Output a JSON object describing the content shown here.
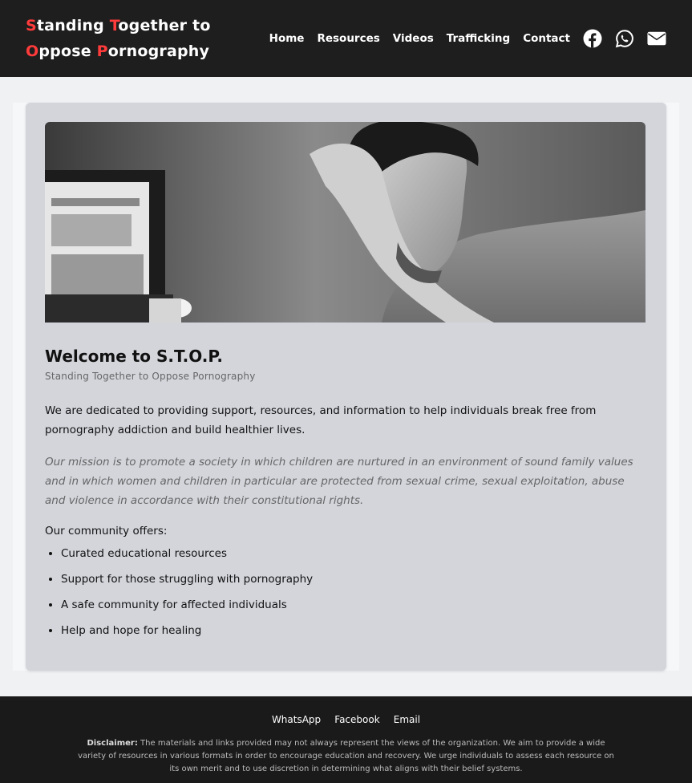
{
  "header": {
    "logo_line1": [
      {
        "accent": "S",
        "rest": "tanding "
      },
      {
        "accent": "T",
        "rest": "ogether to"
      }
    ],
    "logo_line2": [
      {
        "accent": "O",
        "rest": "ppose "
      },
      {
        "accent": "P",
        "rest": "ornography"
      }
    ],
    "nav": [
      "Home",
      "Resources",
      "Videos",
      "Trafficking",
      "Contact"
    ],
    "icons": [
      "facebook-icon",
      "whatsapp-icon",
      "envelope-icon"
    ]
  },
  "hero_image": "grayscale-photo-distressed-young-man-at-computer",
  "content": {
    "title": "Welcome to S.T.O.P.",
    "subtitle": "Standing Together to Oppose Pornography",
    "lead": "We are dedicated to providing support, resources, and information to help individuals break free from pornography addiction and build healthier lives.",
    "mission": "Our mission is to promote a society in which children are nurtured in an environment of sound family values and in which women and children in particular are protected from sexual crime, sexual exploitation, abuse and violence in accordance with their constitutional rights.",
    "offers_label": "Our community offers:",
    "offers": [
      "Curated educational resources",
      "Support for those struggling with pornography",
      "A safe community for affected individuals",
      "Help and hope for healing"
    ]
  },
  "footer": {
    "links": [
      "WhatsApp",
      "Facebook",
      "Email"
    ],
    "disclaimer_label": "Disclaimer:",
    "disclaimer_text": "The materials and links provided may not always represent the views of the organization. We aim to provide a wide variety of resources in various formats in order to encourage education and recovery. We urge individuals to assess each resource on its own merit and to use discretion in determining what aligns with their belief systems."
  },
  "colors": {
    "accent": "#ff3b3b",
    "header_bg": "#1e1e1e",
    "card_bg": "#d3d5db"
  }
}
